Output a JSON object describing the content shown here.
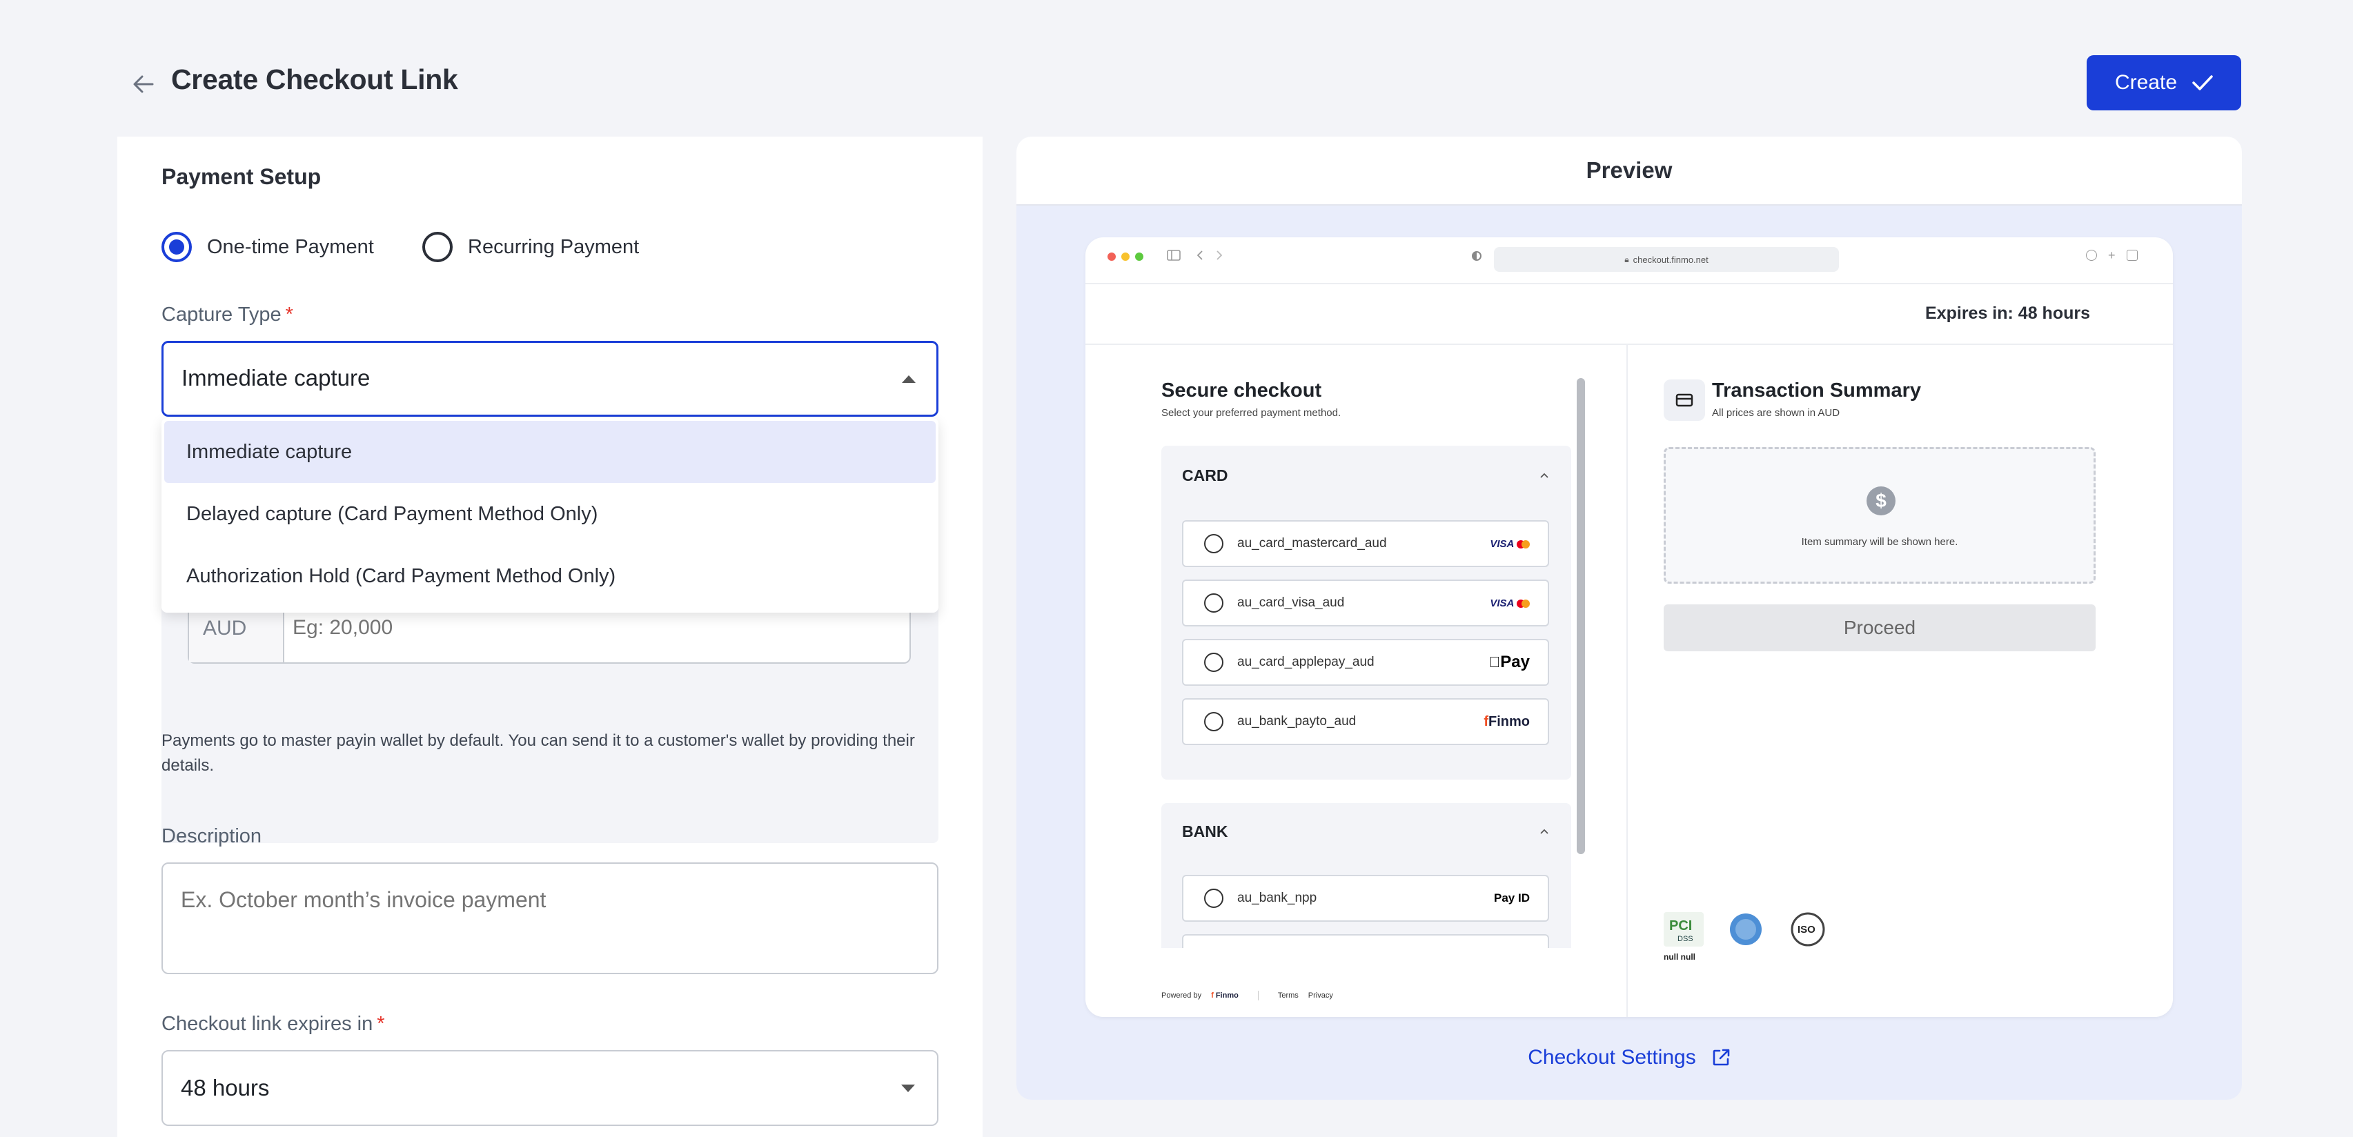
{
  "header": {
    "title": "Create Checkout Link",
    "create_label": "Create"
  },
  "form": {
    "section_title": "Payment Setup",
    "payment_types": [
      {
        "label": "One-time Payment",
        "selected": true
      },
      {
        "label": "Recurring Payment",
        "selected": false
      }
    ],
    "capture_type": {
      "label": "Capture Type",
      "required": "*",
      "value": "Immediate capture",
      "options": [
        "Immediate capture",
        "Delayed capture (Card Payment Method Only)",
        "Authorization Hold (Card Payment Method Only)"
      ]
    },
    "amount": {
      "currency": "AUD",
      "placeholder": "Eg: 20,000"
    },
    "wallet_note": "Payments go to master payin wallet by default. You can send it to a customer's wallet by providing their details.",
    "description": {
      "label": "Description",
      "placeholder": "Ex. October month’s invoice payment"
    },
    "expiry": {
      "label": "Checkout link expires in",
      "required": "*",
      "value": "48 hours"
    }
  },
  "preview": {
    "title": "Preview",
    "url": "checkout.finmo.net",
    "expires": "Expires in: 48 hours",
    "secure_title": "Secure checkout",
    "secure_sub": "Select your preferred payment method.",
    "card_group": "CARD",
    "card_methods": [
      {
        "label": "au_card_mastercard_aud",
        "brand": "VISA"
      },
      {
        "label": "au_card_visa_aud",
        "brand": "VISA"
      },
      {
        "label": "au_card_applepay_aud",
        "brand": "Pay"
      },
      {
        "label": "au_bank_payto_aud",
        "brand": "Finmo"
      }
    ],
    "bank_group": "BANK",
    "bank_methods": [
      {
        "label": "au_bank_npp",
        "brand": "Pay ID"
      }
    ],
    "powered_by": "Powered by",
    "powered_brand": "Finmo",
    "terms": "Terms",
    "privacy": "Privacy",
    "summary_title": "Transaction Summary",
    "summary_sub": "All prices are shown in AUD",
    "summary_placeholder": "Item summary will be shown here.",
    "proceed": "Proceed",
    "badges_caption": "null null",
    "settings_link": "Checkout Settings"
  },
  "colors": {
    "primary": "#1a3ed8",
    "required": "#e5342a",
    "dropdown_selected": "#e6e9fb",
    "preview_bg": "#e9edfb"
  }
}
